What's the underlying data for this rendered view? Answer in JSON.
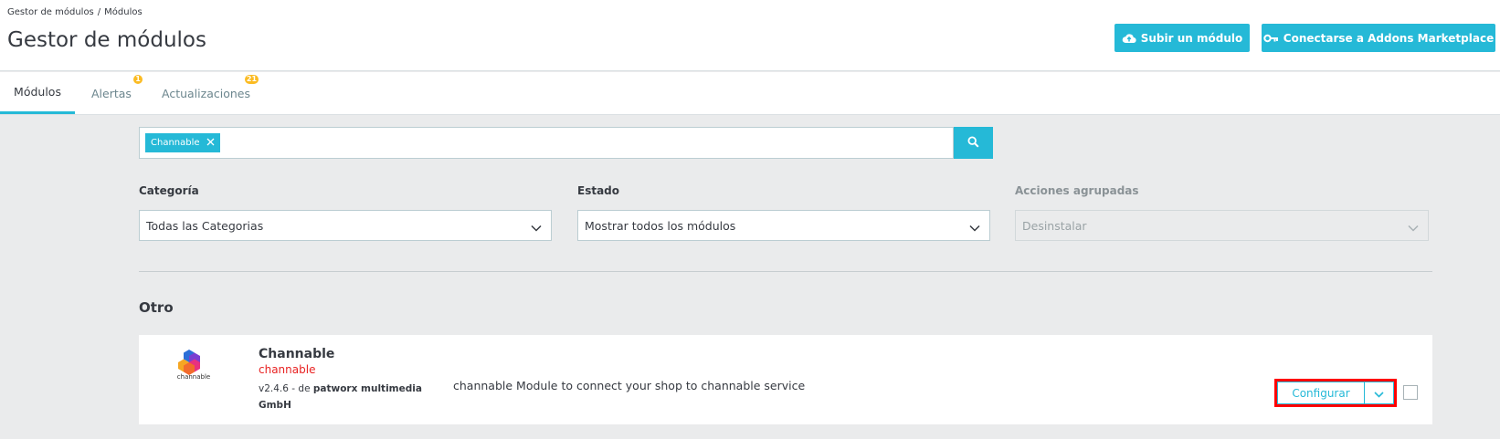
{
  "breadcrumb": {
    "item1": "Gestor de módulos",
    "separator": "/",
    "item2": "Módulos"
  },
  "page_title": "Gestor de módulos",
  "header_buttons": {
    "upload": {
      "label": "Subir un módulo",
      "icon": "cloud-upload-icon"
    },
    "addons": {
      "label": "Conectarse a Addons Marketplace",
      "icon": "key-icon"
    }
  },
  "tabs": [
    {
      "label": "Módulos",
      "active": true
    },
    {
      "label": "Alertas",
      "badge": "1"
    },
    {
      "label": "Actualizaciones",
      "badge": "21"
    }
  ],
  "search": {
    "tag": "Channable",
    "remove_icon": "close-icon",
    "button_icon": "search-icon"
  },
  "filters": {
    "category": {
      "label": "Categoría",
      "value": "Todas las Categorias"
    },
    "status": {
      "label": "Estado",
      "value": "Mostrar todos los módulos"
    },
    "bulk": {
      "label": "Acciones agrupadas",
      "value": "Desinstalar",
      "disabled": true
    }
  },
  "section_title": "Otro",
  "module": {
    "name": "Channable",
    "technical_name": "channable",
    "version": "v2.4.6",
    "by": "- de",
    "author": "patworx multimedia GmbH",
    "description": "channable Module to connect your shop to channable service",
    "logo_text": "channable",
    "configure_label": "Configurar"
  },
  "colors": {
    "accent": "#25b9d7",
    "badge": "#fbbb22",
    "highlight": "#ff0000",
    "tech_name": "#e82222"
  }
}
